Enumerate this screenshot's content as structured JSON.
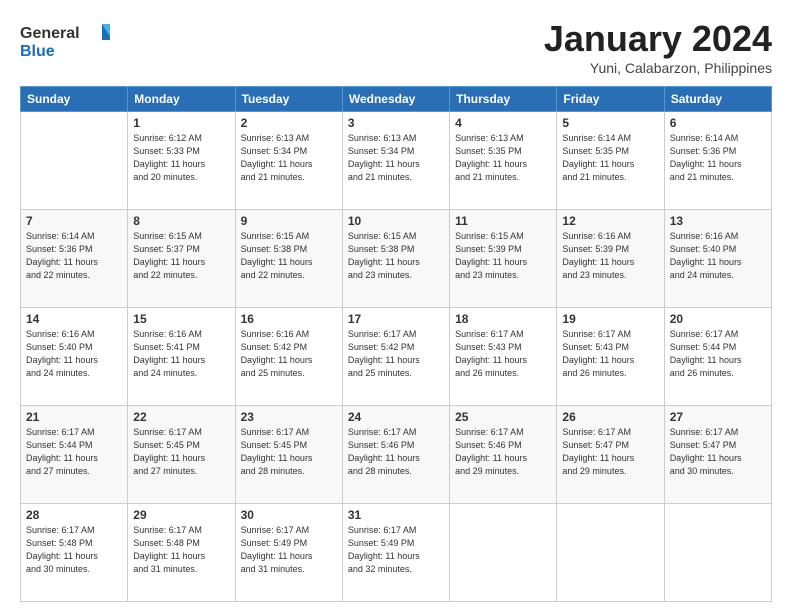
{
  "header": {
    "logo_general": "General",
    "logo_blue": "Blue",
    "month_title": "January 2024",
    "subtitle": "Yuni, Calabarzon, Philippines"
  },
  "days": [
    "Sunday",
    "Monday",
    "Tuesday",
    "Wednesday",
    "Thursday",
    "Friday",
    "Saturday"
  ],
  "weeks": [
    [
      {
        "day": "",
        "info": ""
      },
      {
        "day": "1",
        "info": "Sunrise: 6:12 AM\nSunset: 5:33 PM\nDaylight: 11 hours\nand 20 minutes."
      },
      {
        "day": "2",
        "info": "Sunrise: 6:13 AM\nSunset: 5:34 PM\nDaylight: 11 hours\nand 21 minutes."
      },
      {
        "day": "3",
        "info": "Sunrise: 6:13 AM\nSunset: 5:34 PM\nDaylight: 11 hours\nand 21 minutes."
      },
      {
        "day": "4",
        "info": "Sunrise: 6:13 AM\nSunset: 5:35 PM\nDaylight: 11 hours\nand 21 minutes."
      },
      {
        "day": "5",
        "info": "Sunrise: 6:14 AM\nSunset: 5:35 PM\nDaylight: 11 hours\nand 21 minutes."
      },
      {
        "day": "6",
        "info": "Sunrise: 6:14 AM\nSunset: 5:36 PM\nDaylight: 11 hours\nand 21 minutes."
      }
    ],
    [
      {
        "day": "7",
        "info": "Sunrise: 6:14 AM\nSunset: 5:36 PM\nDaylight: 11 hours\nand 22 minutes."
      },
      {
        "day": "8",
        "info": "Sunrise: 6:15 AM\nSunset: 5:37 PM\nDaylight: 11 hours\nand 22 minutes."
      },
      {
        "day": "9",
        "info": "Sunrise: 6:15 AM\nSunset: 5:38 PM\nDaylight: 11 hours\nand 22 minutes."
      },
      {
        "day": "10",
        "info": "Sunrise: 6:15 AM\nSunset: 5:38 PM\nDaylight: 11 hours\nand 23 minutes."
      },
      {
        "day": "11",
        "info": "Sunrise: 6:15 AM\nSunset: 5:39 PM\nDaylight: 11 hours\nand 23 minutes."
      },
      {
        "day": "12",
        "info": "Sunrise: 6:16 AM\nSunset: 5:39 PM\nDaylight: 11 hours\nand 23 minutes."
      },
      {
        "day": "13",
        "info": "Sunrise: 6:16 AM\nSunset: 5:40 PM\nDaylight: 11 hours\nand 24 minutes."
      }
    ],
    [
      {
        "day": "14",
        "info": "Sunrise: 6:16 AM\nSunset: 5:40 PM\nDaylight: 11 hours\nand 24 minutes."
      },
      {
        "day": "15",
        "info": "Sunrise: 6:16 AM\nSunset: 5:41 PM\nDaylight: 11 hours\nand 24 minutes."
      },
      {
        "day": "16",
        "info": "Sunrise: 6:16 AM\nSunset: 5:42 PM\nDaylight: 11 hours\nand 25 minutes."
      },
      {
        "day": "17",
        "info": "Sunrise: 6:17 AM\nSunset: 5:42 PM\nDaylight: 11 hours\nand 25 minutes."
      },
      {
        "day": "18",
        "info": "Sunrise: 6:17 AM\nSunset: 5:43 PM\nDaylight: 11 hours\nand 26 minutes."
      },
      {
        "day": "19",
        "info": "Sunrise: 6:17 AM\nSunset: 5:43 PM\nDaylight: 11 hours\nand 26 minutes."
      },
      {
        "day": "20",
        "info": "Sunrise: 6:17 AM\nSunset: 5:44 PM\nDaylight: 11 hours\nand 26 minutes."
      }
    ],
    [
      {
        "day": "21",
        "info": "Sunrise: 6:17 AM\nSunset: 5:44 PM\nDaylight: 11 hours\nand 27 minutes."
      },
      {
        "day": "22",
        "info": "Sunrise: 6:17 AM\nSunset: 5:45 PM\nDaylight: 11 hours\nand 27 minutes."
      },
      {
        "day": "23",
        "info": "Sunrise: 6:17 AM\nSunset: 5:45 PM\nDaylight: 11 hours\nand 28 minutes."
      },
      {
        "day": "24",
        "info": "Sunrise: 6:17 AM\nSunset: 5:46 PM\nDaylight: 11 hours\nand 28 minutes."
      },
      {
        "day": "25",
        "info": "Sunrise: 6:17 AM\nSunset: 5:46 PM\nDaylight: 11 hours\nand 29 minutes."
      },
      {
        "day": "26",
        "info": "Sunrise: 6:17 AM\nSunset: 5:47 PM\nDaylight: 11 hours\nand 29 minutes."
      },
      {
        "day": "27",
        "info": "Sunrise: 6:17 AM\nSunset: 5:47 PM\nDaylight: 11 hours\nand 30 minutes."
      }
    ],
    [
      {
        "day": "28",
        "info": "Sunrise: 6:17 AM\nSunset: 5:48 PM\nDaylight: 11 hours\nand 30 minutes."
      },
      {
        "day": "29",
        "info": "Sunrise: 6:17 AM\nSunset: 5:48 PM\nDaylight: 11 hours\nand 31 minutes."
      },
      {
        "day": "30",
        "info": "Sunrise: 6:17 AM\nSunset: 5:49 PM\nDaylight: 11 hours\nand 31 minutes."
      },
      {
        "day": "31",
        "info": "Sunrise: 6:17 AM\nSunset: 5:49 PM\nDaylight: 11 hours\nand 32 minutes."
      },
      {
        "day": "",
        "info": ""
      },
      {
        "day": "",
        "info": ""
      },
      {
        "day": "",
        "info": ""
      }
    ]
  ]
}
